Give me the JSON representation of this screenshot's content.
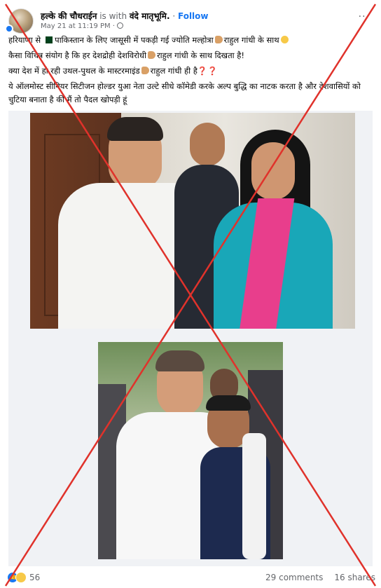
{
  "header": {
    "author": "हल्के की चौधराईन",
    "is_with": "is with",
    "page": "वंदे मातृभूमि.",
    "separator": "·",
    "follow": "Follow",
    "timestamp": "May 21 at 11:19 PM ·",
    "more": "···"
  },
  "body": {
    "line1_a": "हरियाणा से",
    "line1_b": "पाकिस्तान के लिए जासूसी में पकड़ी गई ज्योति मल्होत्रा",
    "line1_c": "राहुल गांधी के साथ",
    "line2_a": "कैसा विचित्र संयोग है कि हर देशद्रोही देशविरोधी",
    "line2_b": "राहुल गांधी के साथ दिखता है!",
    "line3_a": "क्या देश में हो रही उथल-पुथल के मास्टरमाइंड",
    "line3_b": "राहुल गांधी ही है",
    "line3_q": "❓❓",
    "line4": "ये ऑलमोस्ट सीनियर सिटीजन होल्डर युआ नेता उल्टे सीधे कॉमेडी करके अल्प बुद्धि का नाटक करता है और देशवासियों को चुटिया बनाता है की मैं तो पैदल खोपड़ी हूं"
  },
  "footer": {
    "reaction_count": "56",
    "comments": "29 comments",
    "shares": "16 shares"
  },
  "colors": {
    "accent": "#1877f2",
    "cross": "#e0322b",
    "muted": "#65676b"
  }
}
